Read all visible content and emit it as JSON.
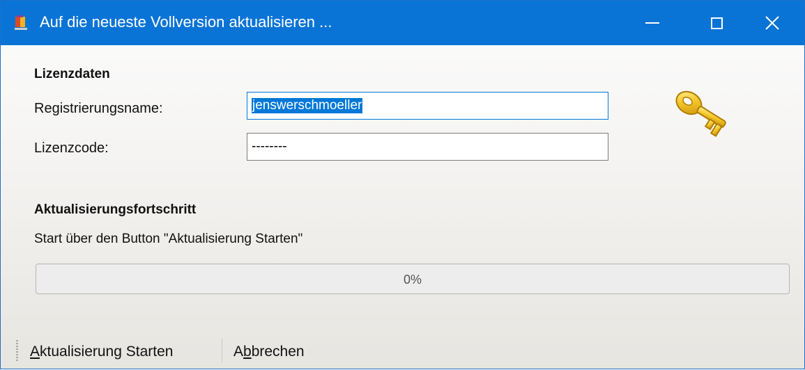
{
  "window": {
    "title": "Auf die neueste Vollversion aktualisieren ..."
  },
  "license": {
    "heading": "Lizenzdaten",
    "name_label": "Registrierungsname:",
    "name_value": "jenswerschmoeller",
    "code_label": "Lizenzcode:",
    "code_value": "--------"
  },
  "progress": {
    "heading": "Aktualisierungsfortschritt",
    "status": "Start über den Button \"Aktualisierung Starten\"",
    "value_percent": 0,
    "label": "0%"
  },
  "toolbar": {
    "start_label": "Aktualisierung Starten",
    "start_mnemonic": "A",
    "cancel_label": "Abbrechen",
    "cancel_mnemonic": "b"
  },
  "icons": {
    "app": "app-icon",
    "minimize": "minimize-icon",
    "maximize": "maximize-icon",
    "close": "close-icon",
    "key": "key-icon"
  },
  "colors": {
    "titlebar": "#0a74d6",
    "selection": "#0078d7",
    "progress_fill": "#06b025"
  }
}
